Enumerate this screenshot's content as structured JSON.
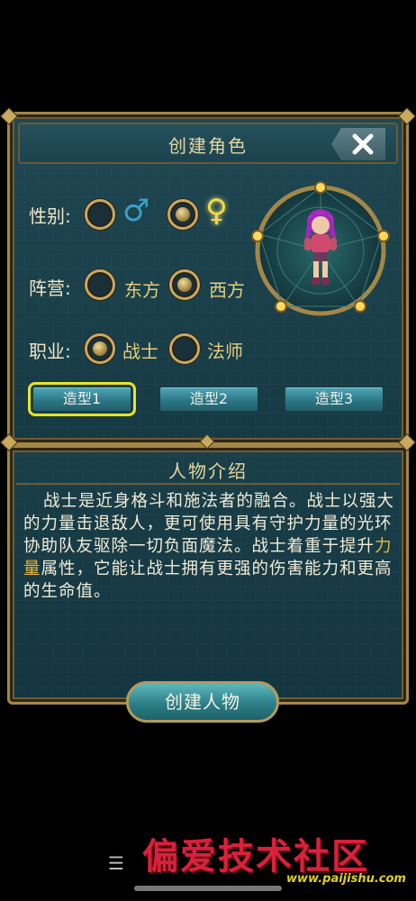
{
  "dialog": {
    "title": "创建角色",
    "close_icon": "close-x-icon"
  },
  "gender": {
    "label": "性别:",
    "options": [
      {
        "symbol": "♂",
        "icon": "male-symbol-icon",
        "selected": false,
        "color": "#3a9fc6"
      },
      {
        "symbol": "♀",
        "icon": "female-symbol-icon",
        "selected": true,
        "color": "#f1d84a"
      }
    ]
  },
  "camp": {
    "label": "阵营:",
    "options": [
      {
        "label": "东方",
        "selected": false
      },
      {
        "label": "西方",
        "selected": true
      }
    ]
  },
  "job": {
    "label": "职业:",
    "options": [
      {
        "label": "战士",
        "selected": true
      },
      {
        "label": "法师",
        "selected": false
      }
    ]
  },
  "models": [
    {
      "label": "造型1",
      "selected": true
    },
    {
      "label": "造型2",
      "selected": false
    },
    {
      "label": "造型3",
      "selected": false
    }
  ],
  "intro": {
    "title": "人物介绍",
    "text_before": "战士是近身格斗和施法者的融合。战士以强大的力量击退敌人，更可使用具有守护力量的光环协助队友驱除一切负面魔法。战士着重于提升",
    "highlight": "力量",
    "text_after": "属性，它能让战士拥有更强的伤害能力和更高的生命值。"
  },
  "create_button": "创建人物",
  "watermark": {
    "text": "偏爱技术社区",
    "url": "www.paijishu.com"
  },
  "nav": {
    "menu_icon": "menu-icon",
    "menu_glyph": "☰"
  },
  "colors": {
    "panel": "#1f4752",
    "frame_gold": "#a38749",
    "highlight_text": "#e8b83a",
    "selected_outline": "#e9e51e"
  }
}
